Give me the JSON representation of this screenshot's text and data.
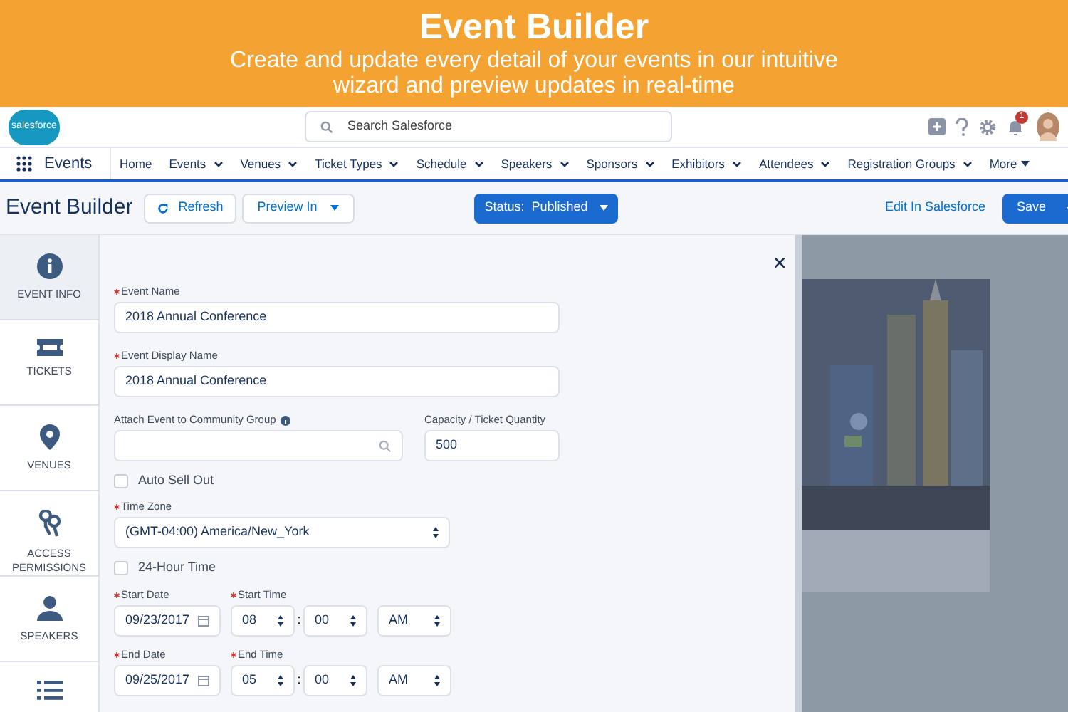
{
  "banner": {
    "title": "Event Builder",
    "subtitle": "Create and update every detail of your events in our intuitive wizard and preview updates in real-time"
  },
  "header": {
    "logo": "salesforce",
    "search": {
      "placeholder": "Search Salesforce"
    },
    "notifications": "1"
  },
  "nav": {
    "app": "Events",
    "items": [
      {
        "label": "Home",
        "menu": false
      },
      {
        "label": "Events",
        "menu": true
      },
      {
        "label": "Venues",
        "menu": true
      },
      {
        "label": "Ticket Types",
        "menu": true
      },
      {
        "label": "Schedule",
        "menu": true
      },
      {
        "label": "Speakers",
        "menu": true
      },
      {
        "label": "Sponsors",
        "menu": true
      },
      {
        "label": "Exhibitors",
        "menu": true
      },
      {
        "label": "Attendees",
        "menu": true
      },
      {
        "label": "Registration Groups",
        "menu": true
      }
    ],
    "more": "More"
  },
  "toolbar": {
    "title": "Event Builder",
    "refresh": "Refresh",
    "preview": "Preview In",
    "status": "Status:  Published",
    "edit_link": "Edit In Salesforce",
    "save": "Save"
  },
  "sidebar": [
    {
      "kind": "info",
      "label": "EVENT INFO",
      "selected": true
    },
    {
      "kind": "ticket",
      "label": "TICKETS",
      "selected": false
    },
    {
      "kind": "pin",
      "label": "VENUES",
      "selected": false
    },
    {
      "kind": "keys",
      "label": "ACCESS PERMISSIONS",
      "selected": false
    },
    {
      "kind": "person",
      "label": "SPEAKERS",
      "selected": false
    },
    {
      "kind": "list",
      "selected": false
    }
  ],
  "form": {
    "event_name": {
      "label": "Event Name",
      "required": true,
      "value": "2018 Annual Conference"
    },
    "display_name": {
      "label": "Event Display Name",
      "required": true,
      "value": "2018 Annual Conference"
    },
    "community_group": {
      "label": "Attach Event to Community Group"
    },
    "capacity": {
      "label": "Capacity / Ticket Quantity",
      "value": "500"
    },
    "auto_sell_out": {
      "label": "Auto Sell Out",
      "checked": false
    },
    "time_zone": {
      "label": "Time Zone",
      "required": true,
      "value": "(GMT-04:00) America/New_York"
    },
    "hour_24": {
      "label": "24-Hour Time",
      "checked": false
    },
    "start": {
      "separator": ":",
      "date_required": true,
      "time_required": true,
      "date_label": "Start Date",
      "time_label": "Start Time",
      "date": "09/23/2017",
      "hour": "08",
      "minute": "00",
      "ampm": "AM"
    },
    "end": {
      "separator": ":",
      "date_required": true,
      "time_required": true,
      "date_label": "End Date",
      "time_label": "End Time",
      "date": "09/25/2017",
      "hour": "05",
      "minute": "00",
      "ampm": "AM"
    }
  }
}
